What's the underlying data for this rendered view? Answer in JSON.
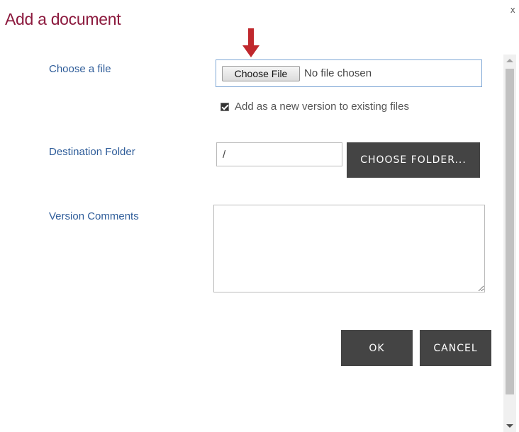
{
  "dialog": {
    "title": "Add a document",
    "close_symbol": "x"
  },
  "fields": {
    "choose_file_label": "Choose a file",
    "choose_file_button": "Choose File",
    "no_file_text": "No file chosen",
    "add_version_label": "Add as a new version to existing files",
    "add_version_checked": true,
    "destination_label": "Destination Folder",
    "destination_value": "/",
    "choose_folder_button": "CHOOSE FOLDER...",
    "comments_label": "Version Comments",
    "comments_value": ""
  },
  "actions": {
    "ok": "OK",
    "cancel": "CANCEL"
  },
  "icons": {
    "arrow": "down-arrow-icon",
    "arrow_color": "#c0282d"
  },
  "colors": {
    "title": "#8c1a3e",
    "label": "#2e5c99",
    "dark_button": "#444444"
  }
}
